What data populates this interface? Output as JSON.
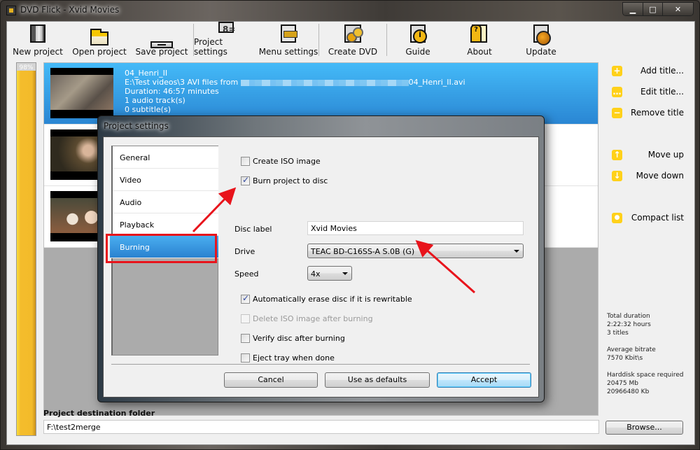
{
  "window": {
    "title": "DVD Flick - Xvid Movies",
    "controls": {
      "minimize": "▁",
      "maximize": "□",
      "close": "✕"
    }
  },
  "toolbar": {
    "buttons": [
      {
        "label": "New project",
        "icon": "film-icon"
      },
      {
        "label": "Open project",
        "icon": "folder-icon"
      },
      {
        "label": "Save project",
        "icon": "drive-icon"
      },
      {
        "label": "Project settings",
        "icon": "settings-icon"
      },
      {
        "label": "Menu settings",
        "icon": "menu-icon"
      },
      {
        "label": "Create DVD",
        "icon": "gears-icon"
      },
      {
        "label": "Guide",
        "icon": "info-icon"
      },
      {
        "label": "About",
        "icon": "about-icon"
      },
      {
        "label": "Update",
        "icon": "globe-icon"
      }
    ]
  },
  "progress": {
    "label": "98%",
    "value_percent": 98
  },
  "titles": [
    {
      "name": "04_Henri_II",
      "path_prefix": "E:\\Test videos\\3 AVI files from",
      "path_suffix": "04_Henri_II.avi",
      "duration": "Duration: 46:57 minutes",
      "audio": "1 audio track(s)",
      "subtitles": "0 subtitle(s)",
      "selected": true
    },
    {
      "name": "",
      "selected": false
    },
    {
      "name": "",
      "selected": false
    }
  ],
  "actions": {
    "add": {
      "label": "Add title...",
      "glyph": "+"
    },
    "edit": {
      "label": "Edit title...",
      "glyph": "…"
    },
    "remove": {
      "label": "Remove title",
      "glyph": "−"
    },
    "move_up": {
      "label": "Move up",
      "glyph": "↑"
    },
    "move_down": {
      "label": "Move down",
      "glyph": "↓"
    },
    "compact": {
      "label": "Compact list",
      "glyph": "●"
    }
  },
  "stats": {
    "total_duration_label": "Total duration",
    "total_duration": "2:22:32 hours",
    "titles_count": "3 titles",
    "avg_bitrate_label": "Average bitrate",
    "avg_bitrate": "7570 Kbit\\s",
    "disk_label": "Harddisk space required",
    "disk_mb": "20475 Mb",
    "disk_kb": "20966480 Kb"
  },
  "destination": {
    "label": "Project destination folder",
    "value": "F:\\test2merge",
    "browse": "Browse..."
  },
  "dialog": {
    "title": "Project settings",
    "nav": [
      "General",
      "Video",
      "Audio",
      "Playback",
      "Burning"
    ],
    "selected_nav": "Burning",
    "options": {
      "create_iso": {
        "label": "Create ISO image",
        "checked": false
      },
      "burn_disc": {
        "label": "Burn project to disc",
        "checked": true
      },
      "auto_erase": {
        "label": "Automatically erase disc if it is rewritable",
        "checked": true
      },
      "delete_iso": {
        "label": "Delete ISO image after burning",
        "checked": false,
        "disabled": true
      },
      "verify": {
        "label": "Verify disc after burning",
        "checked": false
      },
      "eject": {
        "label": "Eject tray when done",
        "checked": false
      }
    },
    "disc_label": {
      "label": "Disc label",
      "value": "Xvid Movies"
    },
    "drive": {
      "label": "Drive",
      "value": "TEAC BD-C16SS-A S.0B (G)"
    },
    "speed": {
      "label": "Speed",
      "value": "4x"
    },
    "buttons": {
      "cancel": "Cancel",
      "defaults": "Use as defaults",
      "accept": "Accept"
    }
  },
  "annotations": {
    "color": "#e8141c"
  }
}
